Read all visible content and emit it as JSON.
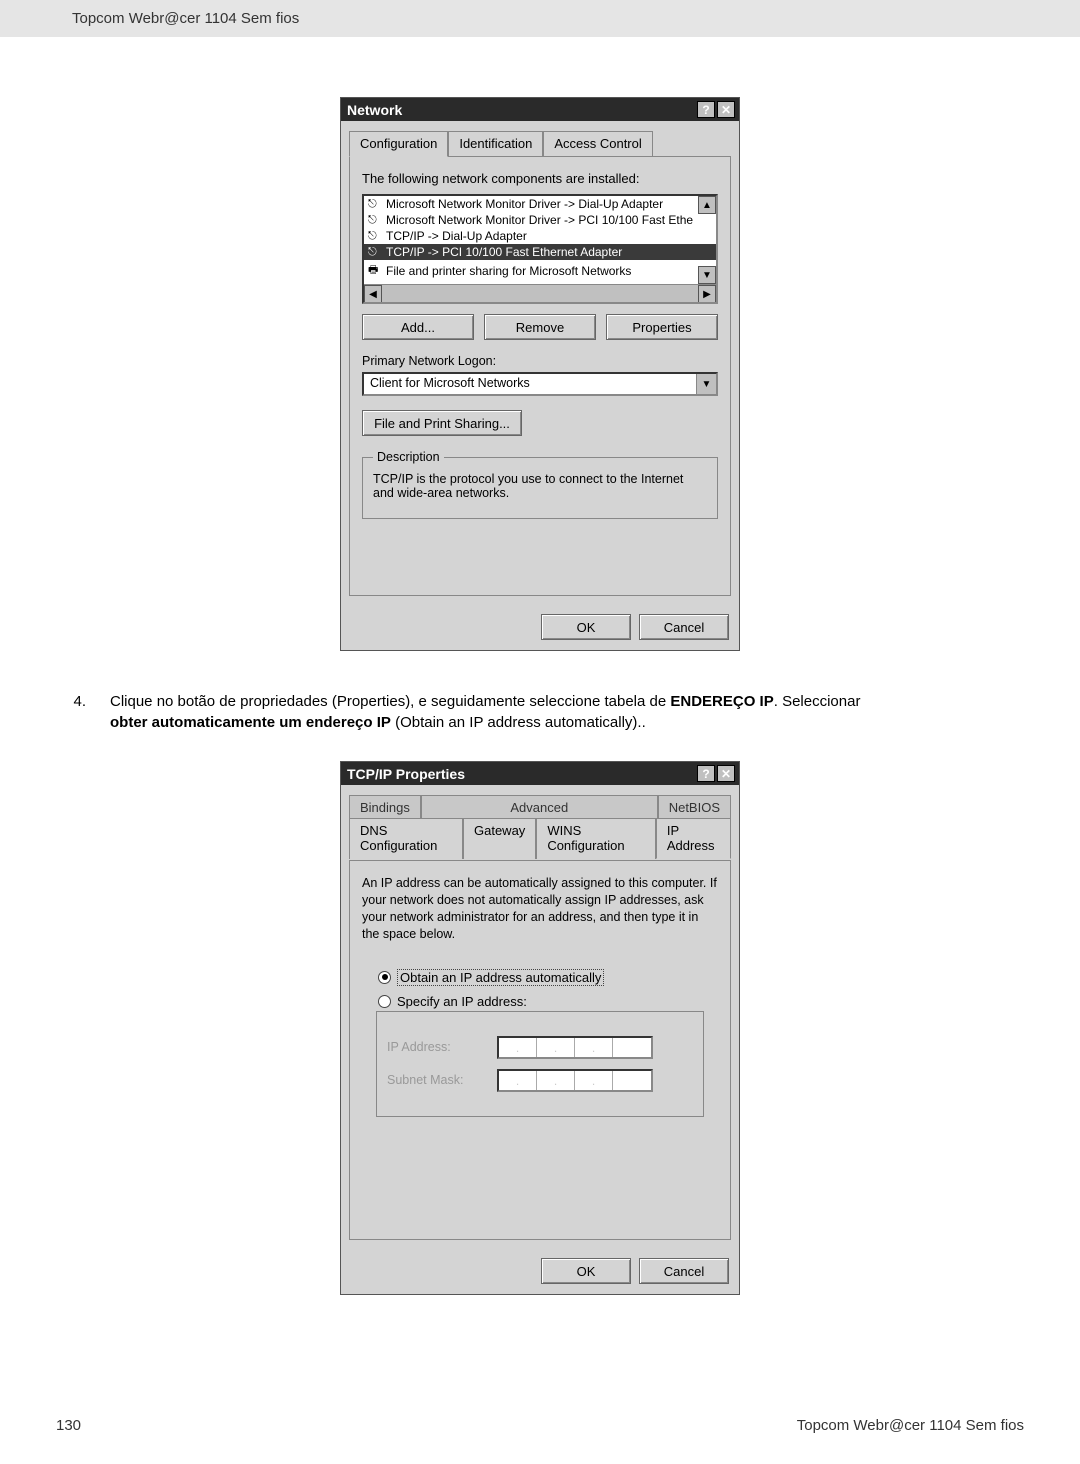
{
  "doc": {
    "header_title": "Topcom  Webr@cer 1104 Sem fios",
    "footer_left": "130",
    "footer_right": "Topcom  Webr@cer 1104 Sem fios"
  },
  "instruction": {
    "number": "4.",
    "line1a": "Clique no botão de propriedades (Properties), e seguidamente seleccione tabela de ",
    "line1b_bold": "ENDEREÇO IP",
    "line1c": ". Seleccionar ",
    "line2_bold": "obter automaticamente um endereço IP",
    "line2_tail": " (Obtain an IP address automatically).."
  },
  "network_dialog": {
    "title": "Network",
    "help_glyph": "?",
    "close_glyph": "✕",
    "tabs": {
      "configuration": "Configuration",
      "identification": "Identification",
      "access_control": "Access Control"
    },
    "installed_label": "The following network components are installed:",
    "components": [
      "Microsoft Network Monitor Driver -> Dial-Up Adapter",
      "Microsoft Network Monitor Driver -> PCI 10/100 Fast Ethe",
      "TCP/IP -> Dial-Up Adapter",
      "TCP/IP -> PCI 10/100 Fast Ethernet Adapter",
      "File and printer sharing for Microsoft Networks"
    ],
    "selected_index": 3,
    "buttons": {
      "add": "Add...",
      "remove": "Remove",
      "properties": "Properties"
    },
    "primary_logon_label": "Primary Network Logon:",
    "primary_logon_value": "Client for Microsoft Networks",
    "file_print_sharing": "File and Print Sharing...",
    "description_legend": "Description",
    "description_text": "TCP/IP is the protocol you use to connect to the Internet and wide-area networks.",
    "ok": "OK",
    "cancel": "Cancel"
  },
  "tcpip_dialog": {
    "title": "TCP/IP Properties",
    "help_glyph": "?",
    "close_glyph": "✕",
    "tabs_row1": {
      "bindings": "Bindings",
      "advanced": "Advanced",
      "netbios": "NetBIOS"
    },
    "tabs_row2": {
      "dns": "DNS Configuration",
      "gateway": "Gateway",
      "wins": "WINS Configuration",
      "ip": "IP Address"
    },
    "panel_text": "An IP address can be automatically assigned to this computer. If your network does not automatically assign IP addresses, ask your network administrator for an address, and then type it in the space below.",
    "radio_obtain": "Obtain an IP address automatically",
    "radio_specify": "Specify an IP address:",
    "ip_label": "IP Address:",
    "subnet_label": "Subnet Mask:",
    "ok": "OK",
    "cancel": "Cancel"
  }
}
